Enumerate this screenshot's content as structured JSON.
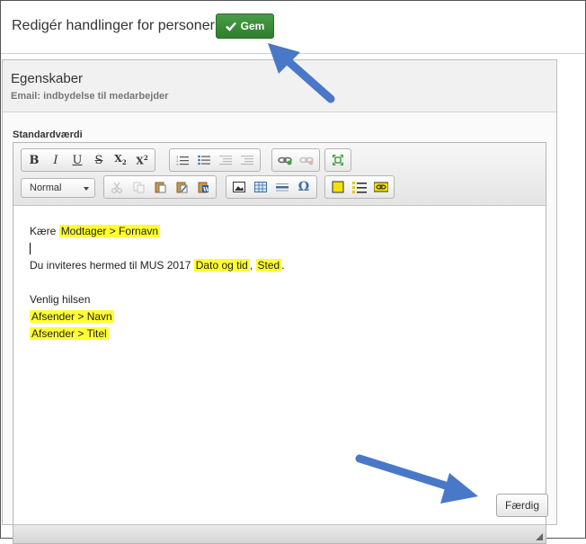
{
  "header": {
    "title": "Redigér handlinger for personer",
    "save_label": "Gem"
  },
  "panel": {
    "title": "Egenskaber",
    "subtitle": "Email: indbydelse til medarbejder"
  },
  "editor": {
    "field_label": "Standardværdi",
    "style_select": "Normal",
    "toolbar": {
      "row1": [
        [
          "bold-button",
          "B"
        ],
        [
          "italic-button",
          "I"
        ],
        [
          "underline-button",
          "U"
        ],
        [
          "strikethrough-button",
          "S"
        ],
        [
          "subscript-button",
          "X₂"
        ],
        [
          "superscript-button",
          "X²"
        ]
      ]
    },
    "content": {
      "greeting": "Kære",
      "recipient_field": "Modtager > Fornavn",
      "body_text": "Du inviteres hermed til MUS 2017",
      "date_field": "Dato og tid",
      "comma": ",",
      "place_field": "Sted",
      "period": ".",
      "closing": "Venlig hilsen",
      "sender_name_field": "Afsender > Navn",
      "sender_title_field": "Afsender > Titel"
    }
  },
  "footer": {
    "done_label": "Færdig"
  },
  "colors": {
    "accent_green": "#3a8a38",
    "highlight": "#ffff33",
    "arrow_blue": "#4a78c8"
  }
}
